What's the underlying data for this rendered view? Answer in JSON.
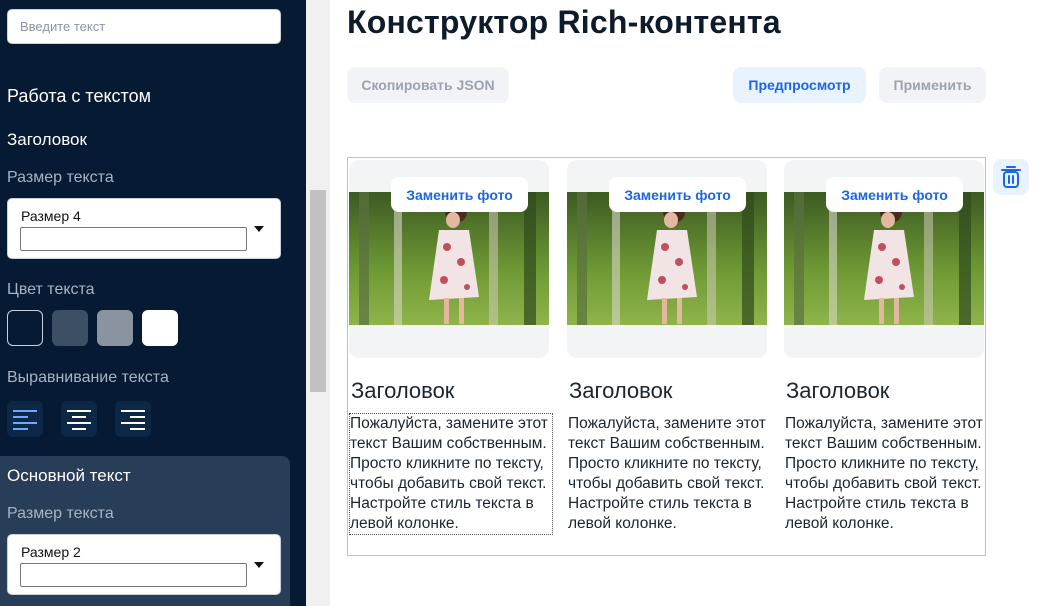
{
  "sidebar": {
    "search_placeholder": "Введите текст",
    "section_title": "Работа с текстом",
    "heading_block": {
      "title": "Заголовок",
      "size_label": "Размер текста",
      "size_value": "Размер 4",
      "color_label": "Цвет текста",
      "colors": [
        "#061a33",
        "#3d4f64",
        "#8a94a0",
        "#ffffff"
      ],
      "align_label": "Выравнивание текста",
      "alignments": [
        "align-left",
        "align-center",
        "align-right"
      ],
      "active_alignment": "align-left"
    },
    "body_block": {
      "title": "Основной текст",
      "size_label": "Размер текста",
      "size_value": "Размер 2"
    }
  },
  "main": {
    "title": "Конструктор Rich-контента",
    "buttons": {
      "copy_json": "Скопировать JSON",
      "preview": "Предпросмотр",
      "apply": "Применить"
    },
    "cards": [
      {
        "replace_label": "Заменить фото",
        "heading": "Заголовок",
        "text": "Пожалуйста, замените этот текст Вашим собственным. Просто кликните по тексту, чтобы добавить свой текст. Настройте стиль текста в левой колонке.",
        "selected": true
      },
      {
        "replace_label": "Заменить фото",
        "heading": "Заголовок",
        "text": "Пожалуйста, замените этот текст Вашим собственным. Просто кликните по тексту, чтобы добавить свой текст. Настройте стиль текста в левой колонке.",
        "selected": false
      },
      {
        "replace_label": "Заменить фото",
        "heading": "Заголовок",
        "text": "Пожалуйста, замените этот текст Вашим собственным. Просто кликните по тексту, чтобы добавить свой текст. Настройте стиль текста в левой колонке.",
        "selected": false
      }
    ]
  },
  "colors": {
    "sidebar_bg": "#061a33",
    "panel_bg": "#283d58",
    "accent": "#1a66e6",
    "accent_soft": "#e8f3ff"
  }
}
